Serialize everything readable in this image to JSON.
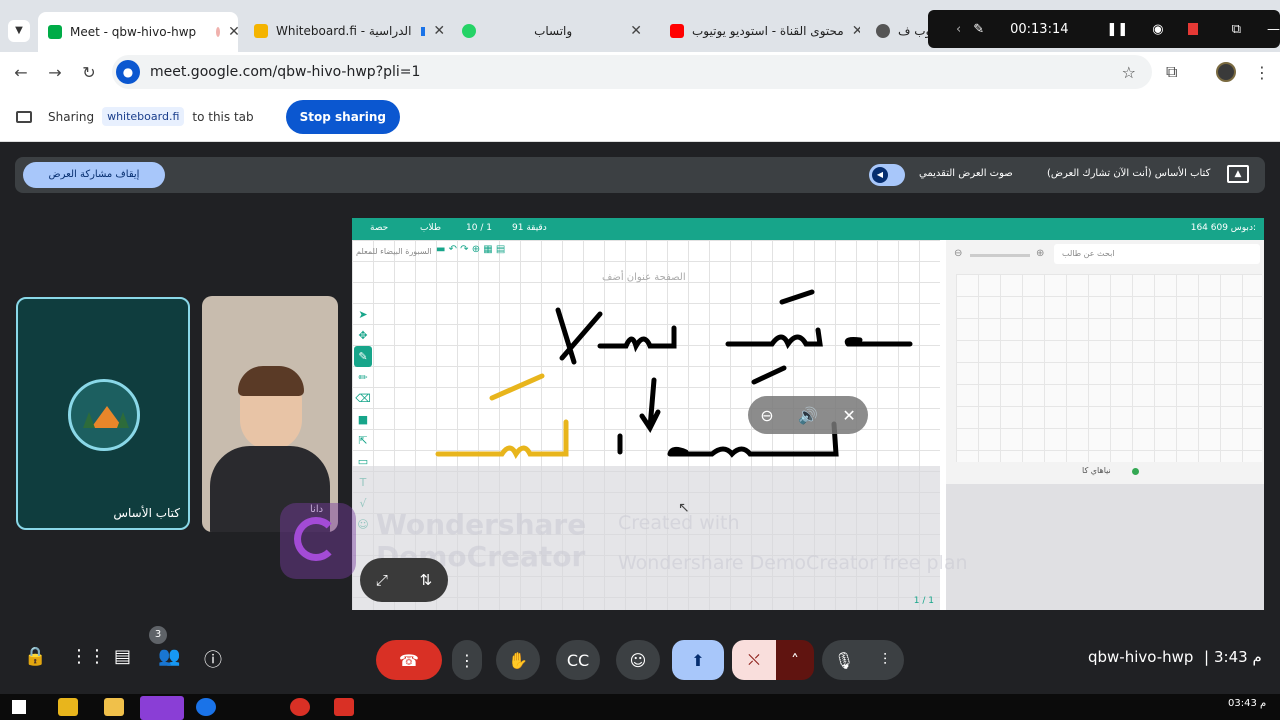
{
  "tabs": [
    {
      "title": "Meet - qbw-hivo-hwp",
      "active": true,
      "favicon_color": "#00ac47"
    },
    {
      "title": "Whiteboard.fi - الدراسية",
      "active": false,
      "favicon_color": "#f4b400"
    },
    {
      "title": "واتساب",
      "active": false,
      "favicon_color": "#25d366"
    },
    {
      "title": "محتوى القناة - استوديو يوتيوب",
      "active": false,
      "favicon_color": "#ff0000"
    },
    {
      "title": "طلوب ف",
      "active": false,
      "favicon_color": "#555555"
    }
  ],
  "recorder": {
    "time": "00:13:14"
  },
  "address": {
    "url": "meet.google.com/qbw-hivo-hwp?pli=1"
  },
  "sharing_bar": {
    "prefix": "Sharing",
    "site": "whiteboard.fi",
    "suffix": "to this tab",
    "stop_label": "Stop sharing"
  },
  "present_bar": {
    "stop_label": "إيقاف مشاركة العرض",
    "audio_label": "صوت العرض التقديمي",
    "presenter_text": "كتاب الأساس (أنت الآن تشارك العرض)"
  },
  "tiles": [
    {
      "name": "كتاب الأساس"
    },
    {
      "name": "دانا"
    }
  ],
  "whiteboard": {
    "top_left_items": [
      "حصة",
      "طلاب",
      "10 / 1",
      "91 دقيقة"
    ],
    "top_right": "164  609  دبوس:",
    "board_title": "السبورة البيضاء للمعلم",
    "page_title_placeholder": "الصفحة عنوان أضف",
    "search_placeholder": "ابحث عن طالب",
    "student_name": "نياهاي كا",
    "page_counter": "1 / 1"
  },
  "watermark": {
    "brand_line1": "Wondershare",
    "brand_line2": "DemoCreator",
    "created_line1": "Created with",
    "created_line2": "Wondershare DemoCreator free plan"
  },
  "controls": {
    "participants_badge": "3",
    "meeting_code": "qbw-hivo-hwp",
    "clock": "3:43 م"
  },
  "taskbar": {
    "clock": "03:43 م"
  },
  "colors": {
    "accent_blue": "#0b57d0",
    "hangup_red": "#d93025",
    "whiteboard_teal": "#17a58a",
    "present_pill": "#a8c7fa",
    "ink_gold": "#e8b51c"
  }
}
